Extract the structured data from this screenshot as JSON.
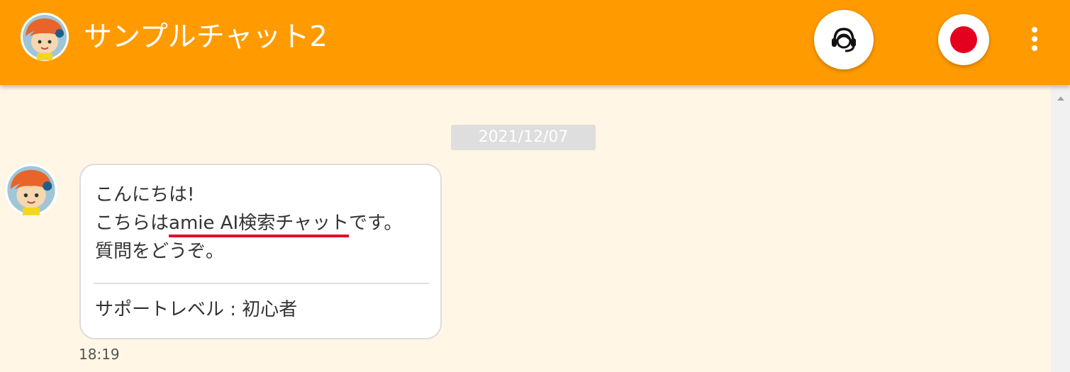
{
  "header": {
    "title": "サンプルチャット2",
    "avatar_icon": "chatbot-avatar-icon",
    "operator_icon": "operator-headset-icon",
    "record_icon": "record-icon",
    "menu_icon": "more-vertical-icon"
  },
  "colors": {
    "header_bg": "#ff9b00",
    "page_bg": "#fff6e6",
    "record": "#e6001f",
    "link_underline": "#e4002b"
  },
  "chat": {
    "date": "2021/12/07",
    "messages": [
      {
        "sender_icon": "chatbot-avatar-icon",
        "line1": "こんにちは!",
        "line2_prefix": "こちらは",
        "line2_link": "amie AI検索チャット",
        "line2_suffix": "です。",
        "line3": "質問をどうぞ。",
        "support_level": "サポートレベル : 初心者",
        "time": "18:19"
      }
    ]
  }
}
